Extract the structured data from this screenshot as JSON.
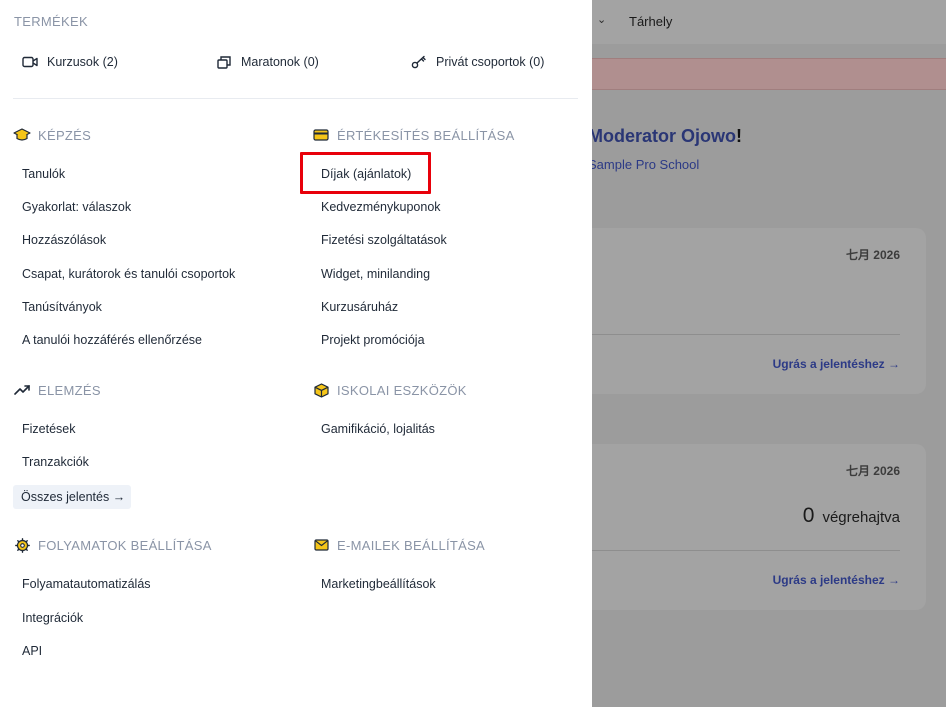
{
  "background": {
    "topbar": {
      "chevron": "⌄",
      "storage": "Tárhely"
    },
    "greeting": {
      "name": "Moderator Ojowo",
      "suffix": "!"
    },
    "school": "Sample Pro School",
    "cards": [
      {
        "date": "七月 2026",
        "link": "Ugrás a jelentéshez →"
      },
      {
        "date": "七月 2026",
        "count": "0",
        "count_label": "végrehajtva",
        "link": "Ugrás a jelentéshez →"
      }
    ]
  },
  "menu": {
    "products_title": "TERMÉKEK",
    "products": [
      {
        "label": "Kurzusok (2)",
        "icon": "video-icon"
      },
      {
        "label": "Maratonok (0)",
        "icon": "stack-icon"
      },
      {
        "label": "Privát csoportok (0)",
        "icon": "key-icon"
      }
    ],
    "sections": {
      "kepzes": {
        "title": "KÉPZÉS",
        "icon": "graduation-cap-icon",
        "items": [
          "Tanulók",
          "Gyakorlat: válaszok",
          "Hozzászólások",
          "Csapat, kurátorok és tanulói csoportok",
          "Tanúsítványok",
          "A tanulói hozzáférés ellenőrzése"
        ]
      },
      "ertekesites": {
        "title": "ÉRTÉKESÍTÉS BEÁLLÍTÁSA",
        "icon": "credit-card-icon",
        "items": [
          "Díjak (ajánlatok)",
          "Kedvezménykuponok",
          "Fizetési szolgáltatások",
          "Widget, minilanding",
          "Kurzusáruház",
          "Projekt promóciója"
        ]
      },
      "elemzes": {
        "title": "ELEMZÉS",
        "icon": "trend-up-icon",
        "items": [
          "Fizetések",
          "Tranzakciók"
        ],
        "all_reports": "Összes jelentés →"
      },
      "iskolai": {
        "title": "ISKOLAI ESZKÖZÖK",
        "icon": "cube-icon",
        "items": [
          "Gamifikáció, lojalitás"
        ]
      },
      "folyamatok": {
        "title": "FOLYAMATOK BEÁLLÍTÁSA",
        "icon": "gear-icon",
        "items": [
          "Folyamatautomatizálás",
          "Integrációk",
          "API"
        ]
      },
      "emailek": {
        "title": "E-MAILEK BEÁLLÍTÁSA",
        "icon": "envelope-icon",
        "items": [
          "Marketingbeállítások"
        ]
      }
    }
  },
  "colors": {
    "highlight": "#e8000a",
    "section_title": "#8a94a6",
    "icon_yellow": "#f5c518",
    "link": "#3b4fd8"
  }
}
